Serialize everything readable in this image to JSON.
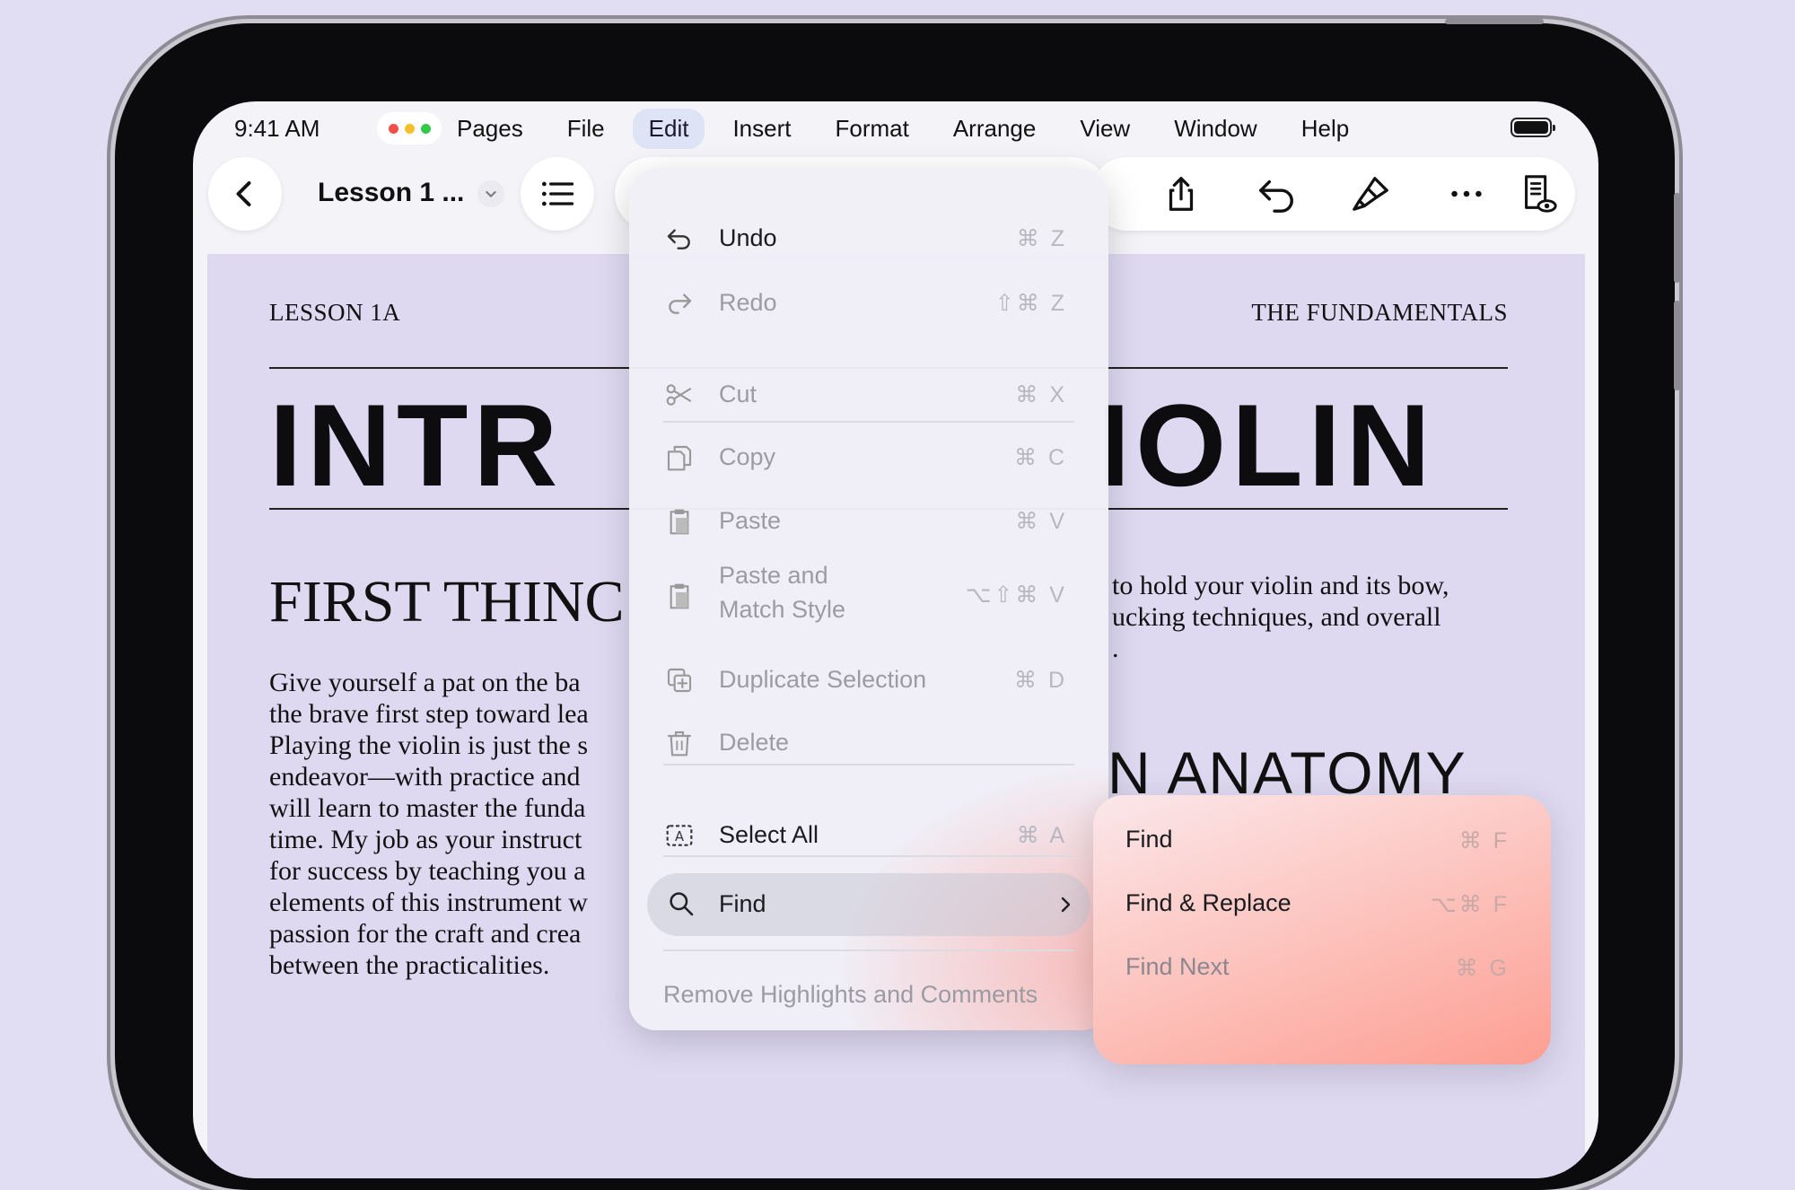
{
  "status_bar": {
    "time": "9:41 AM"
  },
  "menu_bar": {
    "items": [
      "Pages",
      "File",
      "Edit",
      "Insert",
      "Format",
      "Arrange",
      "View",
      "Window",
      "Help"
    ],
    "active": "Edit"
  },
  "toolbar": {
    "doc_title": "Lesson 1 ..."
  },
  "document": {
    "header_left": "LESSON 1A",
    "header_right": "THE FUNDAMENTALS",
    "title_left": "INTR",
    "title_right": "IOLIN",
    "subhead_left": "FIRST THINC",
    "body_lines": [
      "Give yourself a pat on the ba",
      "the brave first step toward lea",
      "Playing the violin is just the s",
      "endeavor—with practice and",
      "will learn to master the funda",
      "time. My job as your instruct",
      "for success by teaching you a",
      "elements of this instrument w",
      "passion for the craft and crea",
      "between the practicalities."
    ],
    "right_lines": [
      "to hold your violin and its bow,",
      "ucking techniques, and overall",
      "."
    ],
    "subhead_right": "N ANATOMY"
  },
  "edit_menu": {
    "undo": {
      "label": "Undo",
      "shortcut": "⌘ Z"
    },
    "redo": {
      "label": "Redo",
      "shortcut": "⇧⌘ Z"
    },
    "cut": {
      "label": "Cut",
      "shortcut": "⌘ X"
    },
    "copy": {
      "label": "Copy",
      "shortcut": "⌘ C"
    },
    "paste": {
      "label": "Paste",
      "shortcut": "⌘ V"
    },
    "paste_match_line1": "Paste and",
    "paste_match_line2": "Match Style",
    "paste_match_shortcut": "⌥⇧⌘ V",
    "duplicate": {
      "label": "Duplicate Selection",
      "shortcut": "⌘ D"
    },
    "delete": {
      "label": "Delete"
    },
    "select_all": {
      "label": "Select All",
      "shortcut": "⌘ A"
    },
    "find": {
      "label": "Find"
    },
    "remove_highlights": "Remove Highlights and Comments"
  },
  "find_menu": {
    "find": {
      "label": "Find",
      "shortcut": "⌘ F"
    },
    "find_replace": {
      "label": "Find & Replace",
      "shortcut": "⌥⌘ F"
    },
    "find_next": {
      "label": "Find Next",
      "shortcut": "⌘ G"
    }
  },
  "colors": {
    "background": "#e1ddf3",
    "page": "#ded9f1",
    "traffic_red": "#f2504b",
    "traffic_yellow": "#f5bf2b",
    "traffic_green": "#34c749"
  }
}
